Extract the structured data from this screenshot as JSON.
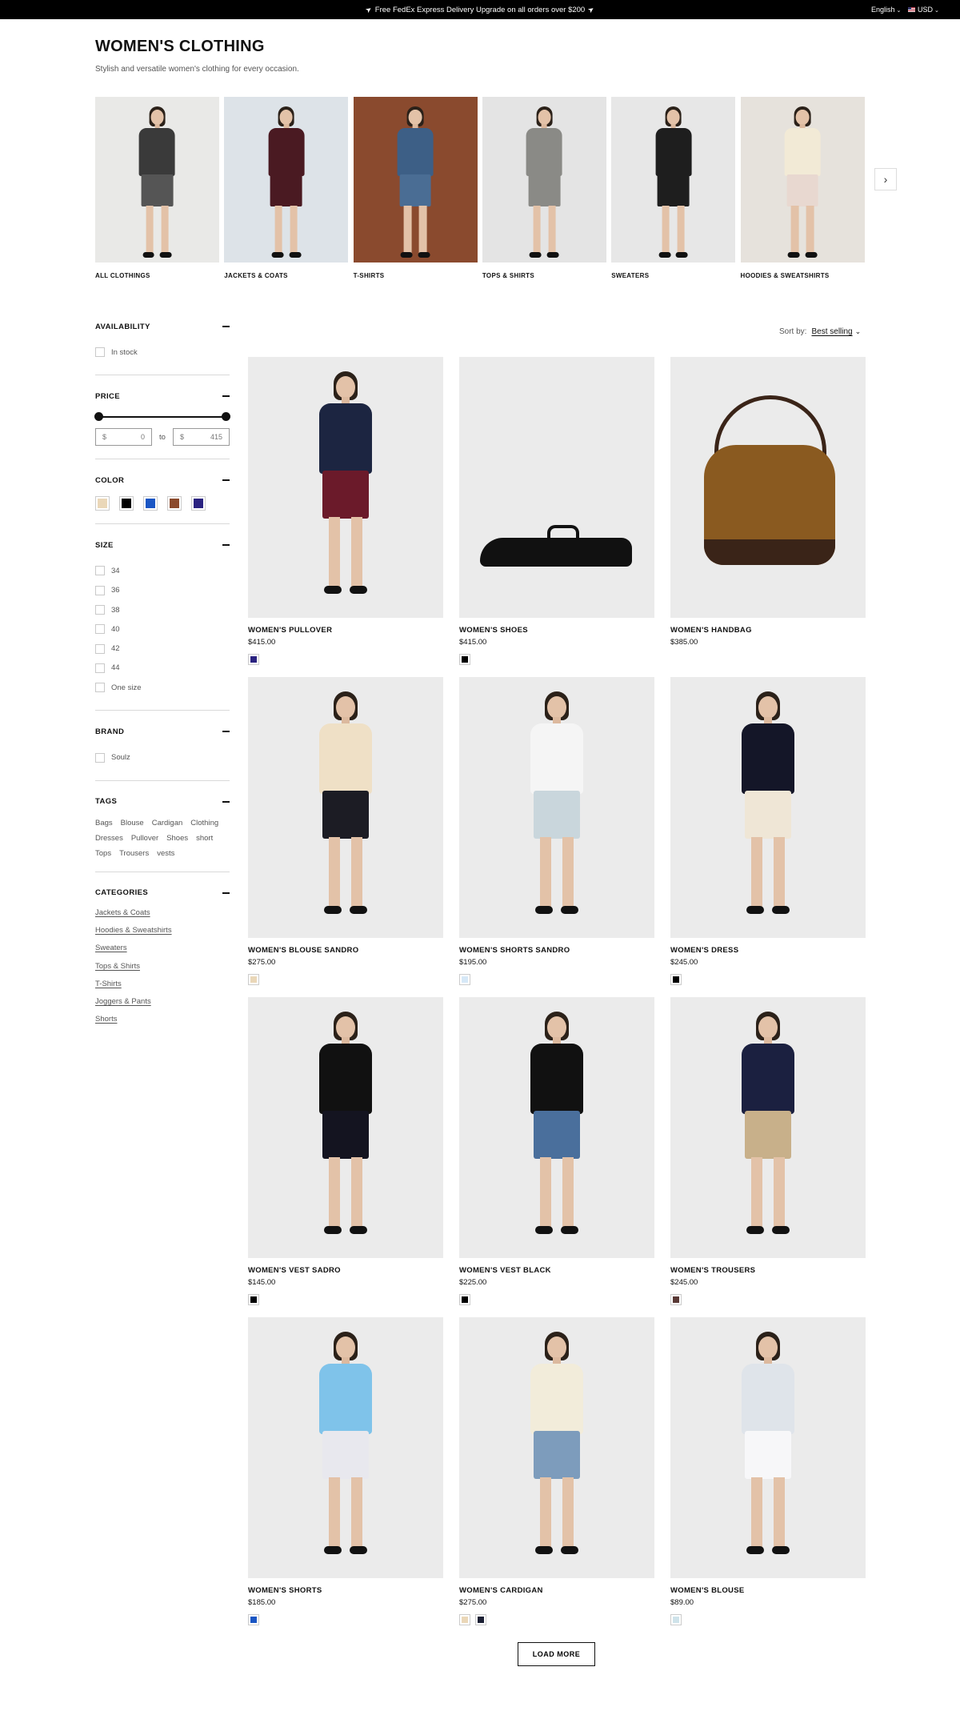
{
  "announcement": {
    "message": "Free FedEx Express Delivery Upgrade on all orders over $200",
    "language": "English",
    "currency": "USD"
  },
  "header": {
    "title": "WOMEN'S CLOTHING",
    "subtitle": "Stylish and versatile women's clothing for every occasion."
  },
  "categories_carousel": [
    {
      "label": "ALL CLOTHINGS",
      "bg": "#e9e9e7",
      "coat": "#3a3a3a",
      "legs": "#555"
    },
    {
      "label": "JACKETS & COATS",
      "bg": "#dde3e8",
      "coat": "#4a1a22",
      "legs": "#4a1a22"
    },
    {
      "label": "T-SHIRTS",
      "bg": "#8a4a2e",
      "coat": "#3d5f86",
      "legs": "#4a6d94"
    },
    {
      "label": "TOPS & SHIRTS",
      "bg": "#e4e4e4",
      "coat": "#8a8a86",
      "legs": "#8a8a86"
    },
    {
      "label": "SWEATERS",
      "bg": "#e7e7e7",
      "coat": "#1e1e1e",
      "legs": "#1e1e1e"
    },
    {
      "label": "HOODIES & SWEATSHIRTS",
      "bg": "#e6e2dc",
      "coat": "#f2ead6",
      "legs": "#e8d8d0"
    }
  ],
  "filters": {
    "availability": {
      "title": "AVAILABILITY",
      "options": [
        "In stock"
      ]
    },
    "price": {
      "title": "PRICE",
      "currency": "$",
      "min": "0",
      "to": "to",
      "max": "415"
    },
    "color": {
      "title": "COLOR",
      "swatches": [
        "#ead7b8",
        "#000000",
        "#1a56c4",
        "#8b4a2c",
        "#2a2280"
      ]
    },
    "size": {
      "title": "SIZE",
      "options": [
        "34",
        "36",
        "38",
        "40",
        "42",
        "44",
        "One size"
      ]
    },
    "brand": {
      "title": "BRAND",
      "options": [
        "Soulz"
      ]
    },
    "tags": {
      "title": "TAGS",
      "items": [
        "Bags",
        "Blouse",
        "Cardigan",
        "Clothing",
        "Dresses",
        "Pullover",
        "Shoes",
        "short",
        "Tops",
        "Trousers",
        "vests"
      ]
    },
    "categories": {
      "title": "CATEGORIES",
      "links": [
        "Jackets & Coats",
        "Hoodies & Sweatshirts",
        "Sweaters",
        "Tops & Shirts",
        "T-Shirts",
        "Joggers & Pants",
        "Shorts"
      ]
    }
  },
  "sort": {
    "label": "Sort by:",
    "value": "Best selling"
  },
  "products": [
    {
      "name": "WOMEN'S PULLOVER",
      "price": "$415.00",
      "swatches": [
        "#2a2280"
      ],
      "kind": "person",
      "top": "#1c2541",
      "bottom": "#6b1a2a"
    },
    {
      "name": "WOMEN'S SHOES",
      "price": "$415.00",
      "swatches": [
        "#000000"
      ],
      "kind": "shoe"
    },
    {
      "name": "WOMEN'S HANDBAG",
      "price": "$385.00",
      "swatches": [],
      "kind": "bag"
    },
    {
      "name": "WOMEN'S BLOUSE SANDRO",
      "price": "$275.00",
      "swatches": [
        "#ead7b8"
      ],
      "kind": "person",
      "top": "#efe0c6",
      "bottom": "#1c1c24"
    },
    {
      "name": "WOMEN'S SHORTS SANDRO",
      "price": "$195.00",
      "swatches": [
        "#d6e8f7"
      ],
      "kind": "person",
      "top": "#f5f5f5",
      "bottom": "#c9d6dc"
    },
    {
      "name": "WOMEN'S DRESS",
      "price": "$245.00",
      "swatches": [
        "#000000"
      ],
      "kind": "person",
      "top": "#141628",
      "bottom": "#efe6d6"
    },
    {
      "name": "WOMEN'S VEST SADRO",
      "price": "$145.00",
      "swatches": [
        "#000000"
      ],
      "kind": "person",
      "top": "#111",
      "bottom": "#141420"
    },
    {
      "name": "WOMEN'S VEST BLACK",
      "price": "$225.00",
      "swatches": [
        "#000000"
      ],
      "kind": "person",
      "top": "#111",
      "bottom": "#4a6f9c"
    },
    {
      "name": "WOMEN'S TROUSERS",
      "price": "$245.00",
      "swatches": [
        "#5a3a36"
      ],
      "kind": "person",
      "top": "#1b2040",
      "bottom": "#c8b08a"
    },
    {
      "name": "WOMEN'S SHORTS",
      "price": "$185.00",
      "swatches": [
        "#1a56c4"
      ],
      "kind": "person",
      "top": "#7fc3ea",
      "bottom": "#e8e8ee"
    },
    {
      "name": "WOMEN'S CARDIGAN",
      "price": "$275.00",
      "swatches": [
        "#ead7b8",
        "#1c2034"
      ],
      "kind": "person",
      "top": "#f2ecda",
      "bottom": "#7d9cbc"
    },
    {
      "name": "WOMEN'S BLOUSE",
      "price": "$89.00",
      "swatches": [
        "#cfe3ea"
      ],
      "kind": "person",
      "top": "#dfe4ea",
      "bottom": "#f7f7f9"
    }
  ],
  "load_more": "LOAD MORE"
}
